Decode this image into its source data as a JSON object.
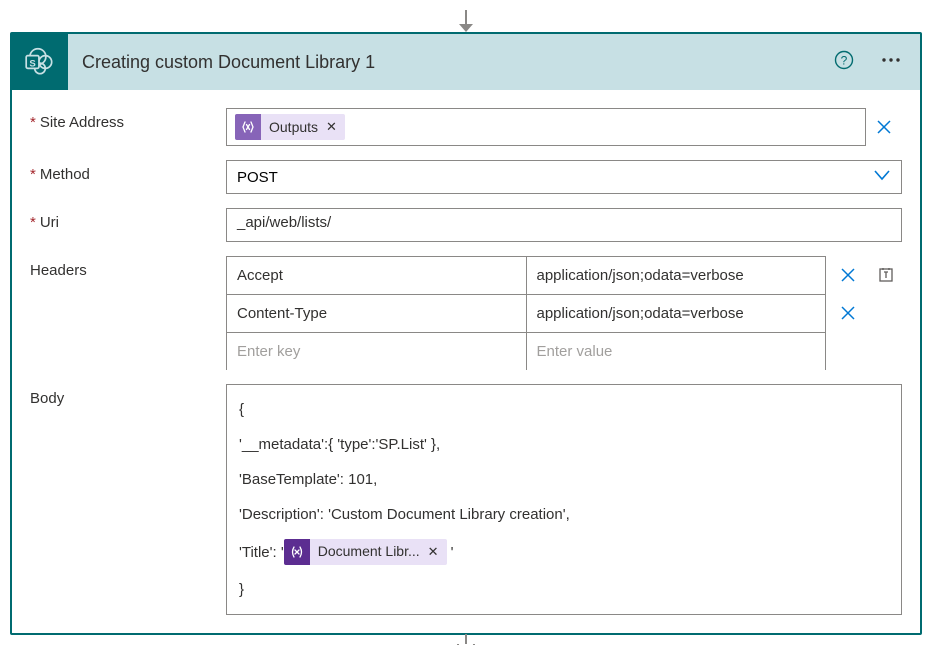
{
  "header": {
    "title": "Creating custom Document Library 1"
  },
  "fields": {
    "siteAddress": {
      "label": "Site Address",
      "token": "Outputs"
    },
    "method": {
      "label": "Method",
      "value": "POST"
    },
    "uri": {
      "label": "Uri",
      "value": "_api/web/lists/"
    },
    "headersLabel": "Headers",
    "headers": [
      {
        "key": "Accept",
        "value": "application/json;odata=verbose"
      },
      {
        "key": "Content-Type",
        "value": "application/json;odata=verbose"
      }
    ],
    "headerPlaceholderKey": "Enter key",
    "headerPlaceholderValue": "Enter value",
    "bodyLabel": "Body",
    "body": {
      "line1": "{",
      "line2": "'__metadata':{ 'type':'SP.List' },",
      "line3": "'BaseTemplate': 101,",
      "line4": "'Description': 'Custom Document Library creation',",
      "line5_pre": "'Title': '",
      "token": "Document Libr...",
      "line5_post": "'",
      "line6": "}"
    }
  }
}
